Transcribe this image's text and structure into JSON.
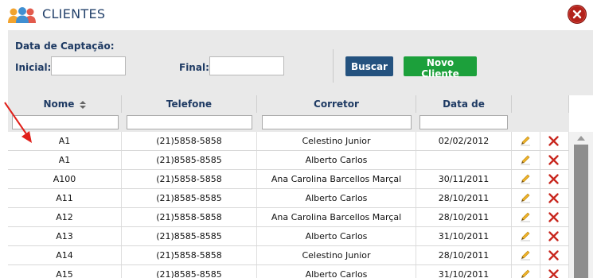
{
  "window": {
    "title": "CLIENTES",
    "app_icon": "users-group-icon",
    "close_icon": "close-icon"
  },
  "filters": {
    "section_label": "Data de Captação:",
    "inicial_label": "Inicial:",
    "inicial_value": "",
    "final_label": "Final:",
    "final_value": "",
    "search_button": "Buscar",
    "new_client_button": "Novo Cliente"
  },
  "table": {
    "columns": {
      "nome": "Nome",
      "telefone": "Telefone",
      "corretor": "Corretor",
      "data": "Data de Captação"
    },
    "sort_icon": "sort-icon",
    "rows": [
      {
        "nome": "A1",
        "telefone": "(21)5858-5858",
        "corretor": "Celestino Junior",
        "data": "02/02/2012"
      },
      {
        "nome": "A1",
        "telefone": "(21)8585-8585",
        "corretor": "Alberto Carlos",
        "data": ""
      },
      {
        "nome": "A100",
        "telefone": "(21)5858-5858",
        "corretor": "Ana Carolina Barcellos Marçal",
        "data": "30/11/2011"
      },
      {
        "nome": "A11",
        "telefone": "(21)8585-8585",
        "corretor": "Alberto Carlos",
        "data": "28/10/2011"
      },
      {
        "nome": "A12",
        "telefone": "(21)5858-5858",
        "corretor": "Ana Carolina Barcellos Marçal",
        "data": "28/10/2011"
      },
      {
        "nome": "A13",
        "telefone": "(21)8585-8585",
        "corretor": "Alberto Carlos",
        "data": "31/10/2011"
      },
      {
        "nome": "A14",
        "telefone": "(21)5858-5858",
        "corretor": "Celestino Junior",
        "data": "28/10/2011"
      },
      {
        "nome": "A15",
        "telefone": "(21)8585-8585",
        "corretor": "Alberto Carlos",
        "data": "31/10/2011"
      }
    ],
    "edit_icon": "pencil-icon",
    "delete_icon": "delete-x-icon"
  },
  "colors": {
    "accent_blue": "#24527f",
    "accent_green": "#1ca03b",
    "delete_red": "#c8261d",
    "close_red": "#b2221b",
    "annotation_arrow": "#e0201a"
  }
}
